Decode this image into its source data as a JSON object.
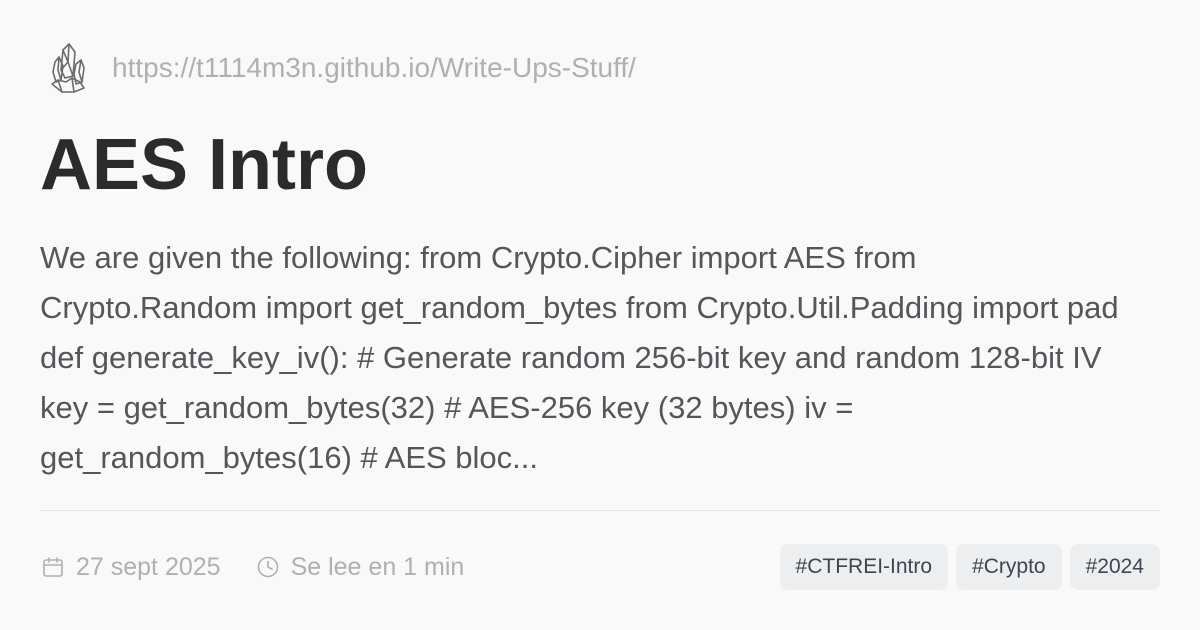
{
  "site": {
    "logo_icon": "crystal-logo-icon",
    "url": "https://t1114m3n.github.io/Write-Ups-Stuff/"
  },
  "post": {
    "title": "AES Intro",
    "summary": "We are given the following: from Crypto.Cipher import AES from Crypto.Random import get_random_bytes from Crypto.Util.Padding import pad def generate_key_iv(): # Generate random 256-bit key and random 128-bit IV key = get_random_bytes(32) # AES-256 key (32 bytes) iv = get_random_bytes(16) # AES bloc...",
    "date_icon": "calendar-icon",
    "date": "27 sept 2025",
    "reading_icon": "clock-icon",
    "reading_time": "Se lee en 1 min",
    "tags": [
      "#CTFREI-Intro",
      "#Crypto",
      "#2024"
    ]
  },
  "colors": {
    "background": "#f9f9fa",
    "title": "#2b2b2d",
    "body_text": "#55555a",
    "muted": "#b0b0b3",
    "tag_bg": "#eceef0",
    "tag_text": "#3c4752"
  }
}
